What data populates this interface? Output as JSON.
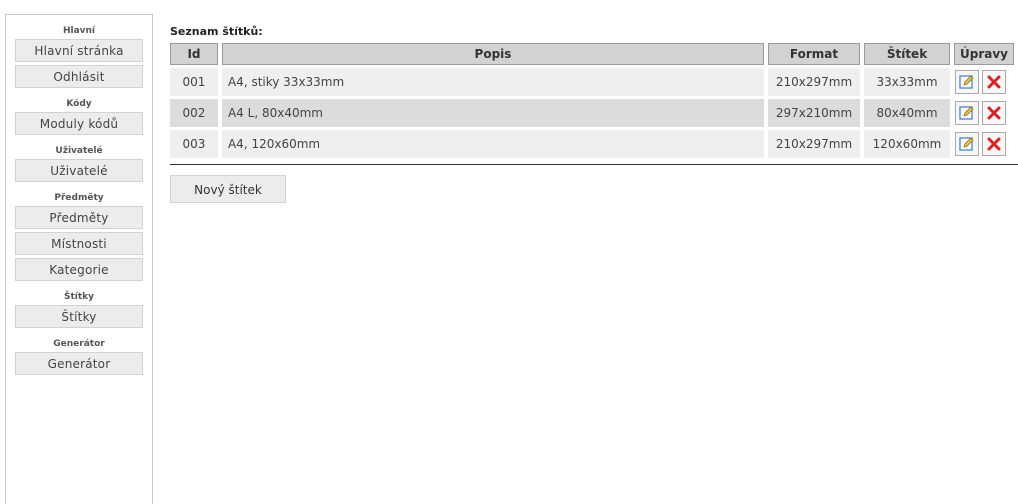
{
  "sidebar": {
    "groups": [
      {
        "heading": "Hlavní",
        "items": [
          "Hlavní stránka",
          "Odhlásit"
        ]
      },
      {
        "heading": "Kódy",
        "items": [
          "Moduly kódů"
        ]
      },
      {
        "heading": "Uživatelé",
        "items": [
          "Uživatelé"
        ]
      },
      {
        "heading": "Předměty",
        "items": [
          "Předměty",
          "Místnosti",
          "Kategorie"
        ]
      },
      {
        "heading": "Štítky",
        "items": [
          "Štítky"
        ]
      },
      {
        "heading": "Generátor",
        "items": [
          "Generátor"
        ]
      }
    ]
  },
  "main": {
    "title": "Seznam štítků:",
    "columns": {
      "id": "Id",
      "popis": "Popis",
      "format": "Format",
      "stitek": "Štítek",
      "upravy": "Úpravy"
    },
    "rows": [
      {
        "id": "001",
        "popis": "A4, stiky 33x33mm",
        "format": "210x297mm",
        "stitek": "33x33mm"
      },
      {
        "id": "002",
        "popis": "A4 L, 80x40mm",
        "format": "297x210mm",
        "stitek": "80x40mm"
      },
      {
        "id": "003",
        "popis": "A4, 120x60mm",
        "format": "210x297mm",
        "stitek": "120x60mm"
      }
    ],
    "new_button": "Nový štítek",
    "icons": {
      "edit": "edit-icon",
      "delete": "delete-icon"
    }
  },
  "colors": {
    "delete": "#e02020",
    "edit": "#3a7bd5",
    "header_bg": "#d2d2d2"
  }
}
